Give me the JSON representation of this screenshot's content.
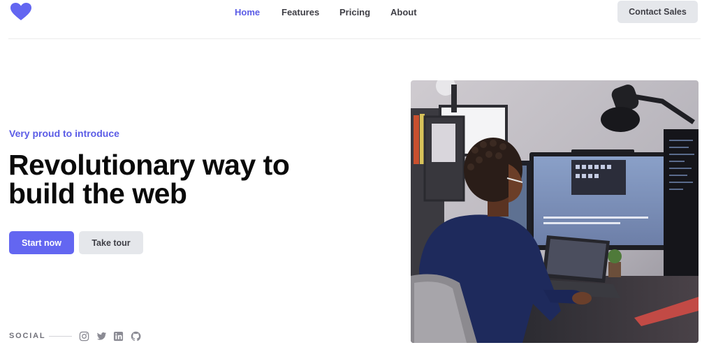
{
  "header": {
    "logo": {
      "icon": "heart-icon",
      "color": "#6366f1"
    },
    "nav": [
      {
        "label": "Home",
        "active": true
      },
      {
        "label": "Features",
        "active": false
      },
      {
        "label": "Pricing",
        "active": false
      },
      {
        "label": "About",
        "active": false
      }
    ],
    "contact_label": "Contact Sales"
  },
  "hero": {
    "eyebrow": "Very proud to introduce",
    "headline_line1": "Revolutionary way to",
    "headline_line2": "build the web",
    "primary_button": "Start now",
    "secondary_button": "Take tour",
    "image": {
      "subject": "person working at desk with multiple monitors"
    }
  },
  "social": {
    "label": "SOCIAL",
    "icons": [
      "instagram-icon",
      "twitter-icon",
      "linkedin-icon",
      "github-icon"
    ]
  },
  "colors": {
    "accent": "#6366f1",
    "accent_text": "#5b5ce6",
    "muted_button": "#e5e7eb",
    "heading": "#0a0a0a"
  }
}
